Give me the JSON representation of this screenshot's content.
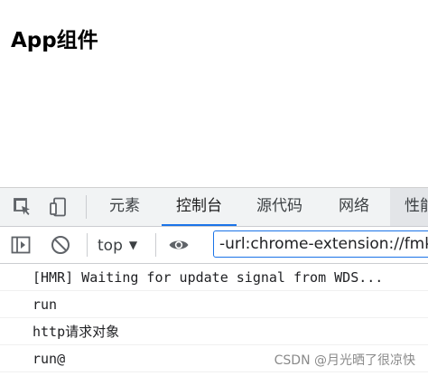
{
  "page": {
    "title": "App组件"
  },
  "devtools": {
    "tabs": [
      {
        "label": "元素",
        "active": false
      },
      {
        "label": "控制台",
        "active": true
      },
      {
        "label": "源代码",
        "active": false
      },
      {
        "label": "网络",
        "active": false
      },
      {
        "label": "性能",
        "active": false
      }
    ],
    "toolbar_icons": {
      "inspect": "inspect-element-icon",
      "device": "device-toolbar-icon"
    },
    "console_toolbar": {
      "context": "top",
      "filter_value": "-url:chrome-extension://fmkadmapgofadopljbjfkapdkoienihi"
    },
    "messages": [
      "[HMR] Waiting for update signal from WDS...",
      "run",
      "http请求对象",
      "run@"
    ]
  },
  "watermark": "CSDN @月光晒了很凉快",
  "colors": {
    "accent": "#1a73e8",
    "tabbar_bg": "#f1f3f4"
  }
}
